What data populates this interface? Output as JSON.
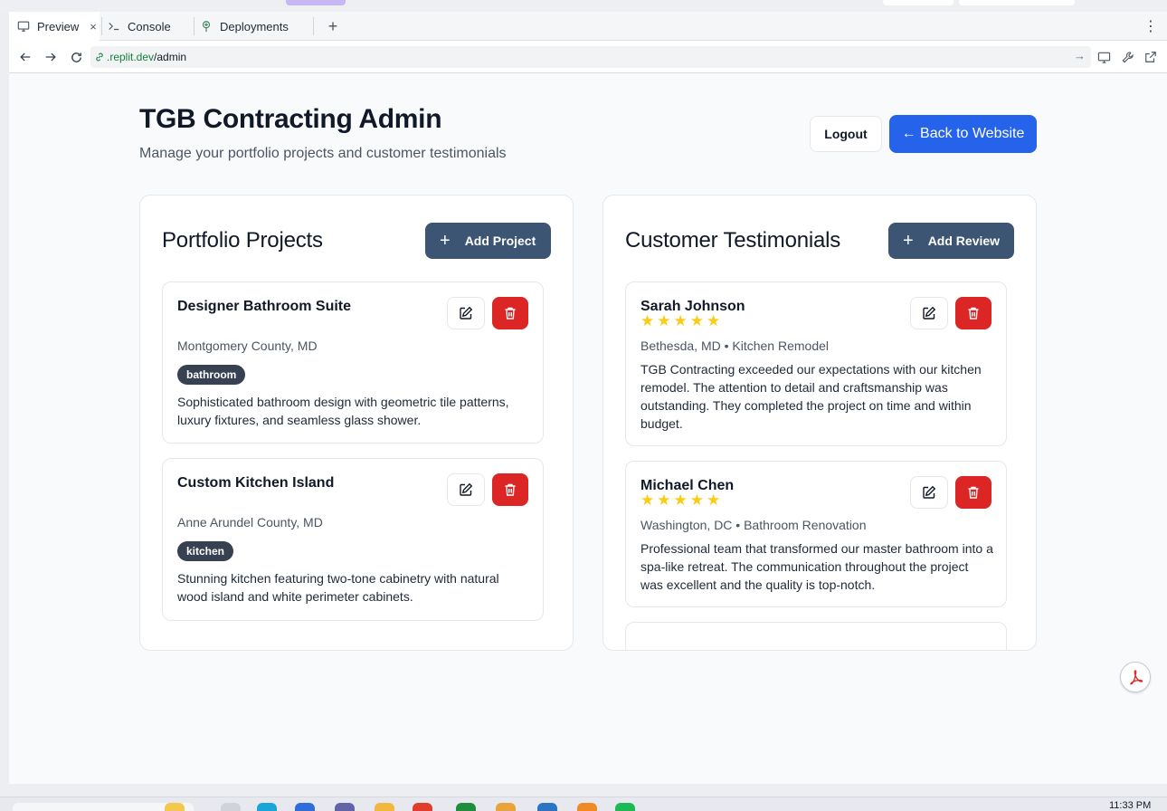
{
  "browser": {
    "tabs": [
      {
        "label": "Preview",
        "icon": "monitor-icon",
        "close": "×"
      },
      {
        "label": "Console",
        "icon": "terminal-icon"
      },
      {
        "label": "Deployments",
        "icon": "deployments-icon"
      }
    ],
    "new_tab": "+",
    "menu": "⋮",
    "url_domain": ".replit.dev",
    "url_path": "/admin"
  },
  "header": {
    "title": "TGB Contracting Admin",
    "subtitle": "Manage your portfolio projects and customer testimonials",
    "logout_label": "Logout",
    "back_label": "← Back to Website"
  },
  "portfolio": {
    "title": "Portfolio Projects",
    "add_label": "Add Project",
    "projects": [
      {
        "title": "Designer Bathroom Suite",
        "location": "Montgomery County, MD",
        "tag": "bathroom",
        "description": "Sophisticated bathroom design with geometric tile patterns, luxury fixtures, and seamless glass shower."
      },
      {
        "title": "Custom Kitchen Island",
        "location": "Anne Arundel County, MD",
        "tag": "kitchen",
        "description": "Stunning kitchen featuring two-tone cabinetry with natural wood island and white perimeter cabinets."
      }
    ]
  },
  "testimonials": {
    "title": "Customer Testimonials",
    "add_label": "Add Review",
    "reviews": [
      {
        "name": "Sarah Johnson",
        "rating": 5,
        "meta": "Bethesda, MD • Kitchen Remodel",
        "text": "TGB Contracting exceeded our expectations with our kitchen remodel. The attention to detail and craftsmanship was outstanding. They completed the project on time and within budget."
      },
      {
        "name": "Michael Chen",
        "rating": 5,
        "meta": "Washington, DC • Bathroom Renovation",
        "text": "Professional team that transformed our master bathroom into a spa-like retreat. The communication throughout the project was excellent and the quality is top-notch."
      }
    ]
  },
  "taskbar": {
    "clock": "11:33 PM"
  },
  "colors": {
    "primary_blue": "#2563eb",
    "slate_button": "#3b5573",
    "delete_red": "#dc2626",
    "star_yellow": "#facc15",
    "url_green": "#15803d"
  }
}
